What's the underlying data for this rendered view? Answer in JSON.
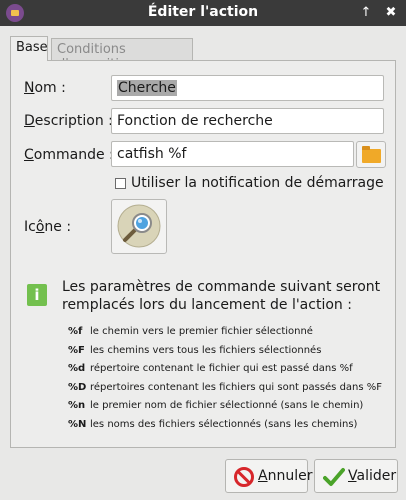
{
  "window": {
    "title": "Éditer l'action",
    "up_glyph": "↑",
    "close_glyph": "✖"
  },
  "tabs": [
    {
      "label": "Base",
      "active": true
    },
    {
      "label": "Conditions d'apparition",
      "active": false
    }
  ],
  "form": {
    "name_label_mnemonic": "N",
    "name_label_rest": "om :",
    "name_value": "Cherche",
    "description_label_mnemonic": "D",
    "description_label_rest": "escription :",
    "description_value": "Fonction de recherche",
    "command_label_mnemonic": "C",
    "command_label_rest": "ommande :",
    "command_value": "catfish %f",
    "startup_notification_label": "Utiliser la notification de démarrage",
    "startup_notification_checked": false,
    "icon_label_before": "Ic",
    "icon_label_mnemonic": "ô",
    "icon_label_after": "ne :",
    "icon_name": "search-icon"
  },
  "info": {
    "text": "Les paramètres de commande suivant seront remplacés lors du lancement de l'action :",
    "params": [
      {
        "code": "%f",
        "desc": "le chemin vers le premier fichier sélectionné"
      },
      {
        "code": "%F",
        "desc": "les chemins vers tous les fichiers sélectionnés"
      },
      {
        "code": "%d",
        "desc": "répertoire contenant le fichier qui est passé dans %f"
      },
      {
        "code": "%D",
        "desc": "répertoires contenant les fichiers qui sont passés dans %F"
      },
      {
        "code": "%n",
        "desc": "le premier nom de fichier sélectionné (sans le chemin)"
      },
      {
        "code": "%N",
        "desc": "les noms des fichiers sélectionnés (sans les chemins)"
      }
    ]
  },
  "buttons": {
    "cancel_mnemonic": "A",
    "cancel_rest": "nnuler",
    "validate_mnemonic": "V",
    "validate_rest": "alider"
  },
  "colors": {
    "titlebar": "#3a3a3a",
    "info_icon": "#73c04e",
    "cancel_icon": "#d7262b",
    "validate_icon": "#4aa329",
    "folder": "#f0a928"
  }
}
